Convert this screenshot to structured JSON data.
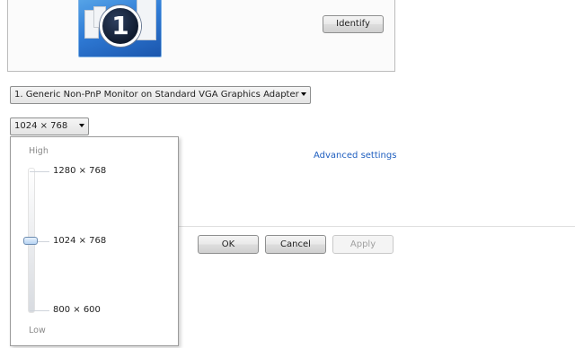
{
  "preview": {
    "monitor_number": "1",
    "identify_label": "Identify"
  },
  "display_select": {
    "value": "1. Generic Non-PnP Monitor on Standard VGA Graphics Adapter"
  },
  "resolution_select": {
    "value": "1024 × 768"
  },
  "advanced_settings_label": "Advanced settings",
  "resolution_popup": {
    "high_label": "High",
    "low_label": "Low",
    "options": [
      "1280 × 768",
      "1024 × 768",
      "800 × 600"
    ],
    "selected": "1024 × 768"
  },
  "buttons": {
    "ok": "OK",
    "cancel": "Cancel",
    "apply": "Apply"
  }
}
